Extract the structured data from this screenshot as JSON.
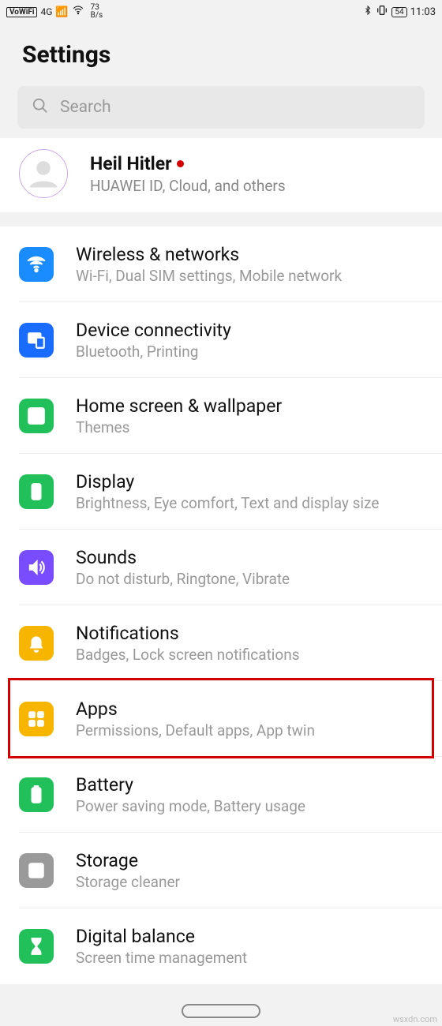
{
  "status": {
    "vowifi": "VoWiFi",
    "net": "4G",
    "speed_val": "73",
    "speed_unit": "B/s",
    "battery": "54",
    "time": "11:03"
  },
  "page_title": "Settings",
  "search": {
    "placeholder": "Search"
  },
  "account": {
    "name": "Heil Hitler",
    "subtitle": "HUAWEI ID, Cloud, and others"
  },
  "items": [
    {
      "icon": "wifi",
      "color": "#1a8cff",
      "title": "Wireless & networks",
      "sub": "Wi-Fi, Dual SIM settings, Mobile network"
    },
    {
      "icon": "devices",
      "color": "#1a6bff",
      "title": "Device connectivity",
      "sub": "Bluetooth, Printing"
    },
    {
      "icon": "wallpaper",
      "color": "#22c05a",
      "title": "Home screen & wallpaper",
      "sub": "Themes"
    },
    {
      "icon": "display",
      "color": "#22c05a",
      "title": "Display",
      "sub": "Brightness, Eye comfort, Text and display size"
    },
    {
      "icon": "sound",
      "color": "#7a4cff",
      "title": "Sounds",
      "sub": "Do not disturb, Ringtone, Vibrate"
    },
    {
      "icon": "bell",
      "color": "#f7b500",
      "title": "Notifications",
      "sub": "Badges, Lock screen notifications"
    },
    {
      "icon": "apps",
      "color": "#f7b500",
      "title": "Apps",
      "sub": "Permissions, Default apps, App twin"
    },
    {
      "icon": "battery",
      "color": "#22c05a",
      "title": "Battery",
      "sub": "Power saving mode, Battery usage"
    },
    {
      "icon": "storage",
      "color": "#9a9a9a",
      "title": "Storage",
      "sub": "Storage cleaner"
    },
    {
      "icon": "hourglass",
      "color": "#22c05a",
      "title": "Digital balance",
      "sub": "Screen time management"
    }
  ],
  "highlight_index": 6,
  "watermark": "wsxdn.com"
}
